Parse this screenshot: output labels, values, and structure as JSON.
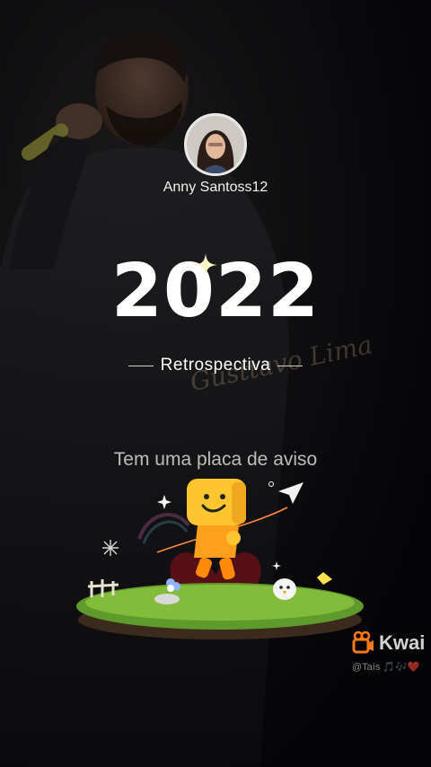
{
  "profile": {
    "username": "Anny Santoss12",
    "avatar_icon": "profile-photo"
  },
  "recap": {
    "year": "2022",
    "subtitle": "Retrospectiva",
    "caption": "Tem uma placa de aviso",
    "background_signature": "Gusttavo Lima"
  },
  "watermark": {
    "brand": "Kwai",
    "handle": "@Taís 🎵🎶❤️",
    "brand_color": "#ff7a1a"
  },
  "icons": {
    "sparkle": "sparkle-icon",
    "paper_plane": "paper-plane-icon",
    "mascot": "kwai-mascot-icon",
    "kwai_logo": "kwai-logo-icon"
  }
}
